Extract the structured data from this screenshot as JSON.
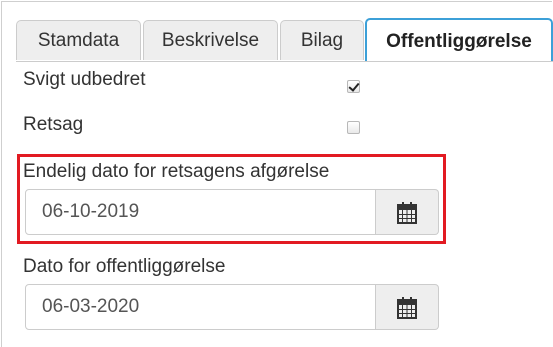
{
  "tabs": [
    {
      "label": "Stamdata",
      "active": false
    },
    {
      "label": "Beskrivelse",
      "active": false
    },
    {
      "label": "Bilag",
      "active": false
    },
    {
      "label": "Offentliggørelse",
      "active": true
    }
  ],
  "fields": {
    "svigt_udbedret": {
      "label": "Svigt udbedret",
      "checked": true
    },
    "retsag": {
      "label": "Retsag",
      "checked": false
    },
    "endelig_dato": {
      "label": "Endelig dato for retsagens afgørelse",
      "value": "06-10-2019",
      "icon": "calendar-icon"
    },
    "dato_offentliggoerelse": {
      "label": "Dato for offentliggørelse",
      "value": "06-03-2020",
      "icon": "calendar-icon"
    }
  },
  "colors": {
    "active_tab_border": "#3ca0d8",
    "highlight_border": "#e21a22",
    "button_bg": "#eeeeee"
  }
}
